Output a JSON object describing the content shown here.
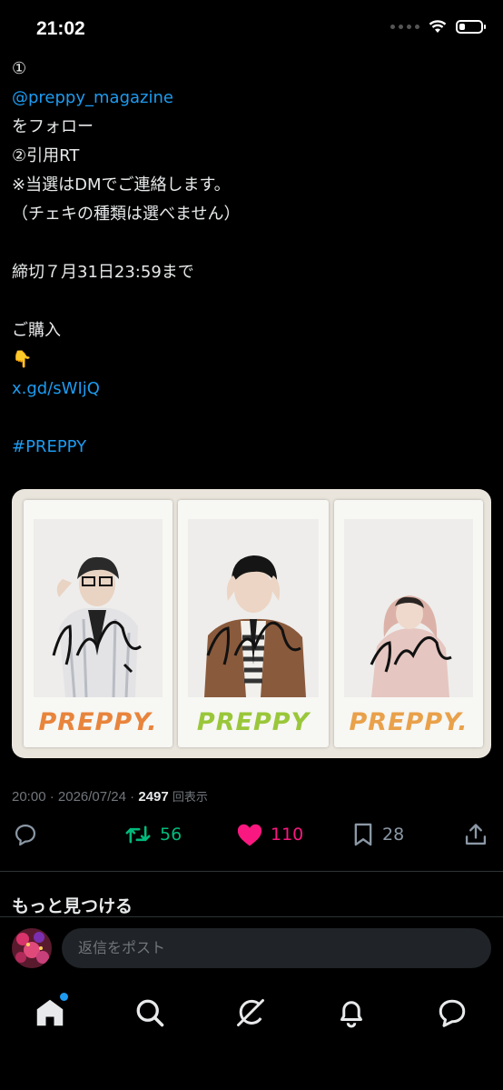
{
  "status_bar": {
    "time": "21:02"
  },
  "tweet": {
    "lines": [
      {
        "text": "①",
        "type": "text"
      },
      {
        "text": "@preppy_magazine",
        "type": "link"
      },
      {
        "text": "をフォロー",
        "type": "text"
      },
      {
        "text": "②引用RT",
        "type": "text"
      },
      {
        "text": "※当選はDMでご連絡します。",
        "type": "text"
      },
      {
        "text": "（チェキの種類は選べません）",
        "type": "text"
      },
      {
        "text": "",
        "type": "text"
      },
      {
        "text": "締切７月31日23:59まで",
        "type": "text"
      },
      {
        "text": "",
        "type": "text"
      },
      {
        "text": "ご購入",
        "type": "text"
      },
      {
        "text": "👇",
        "type": "emoji"
      },
      {
        "text": "x.gd/sWIjQ",
        "type": "link"
      },
      {
        "text": "",
        "type": "text"
      },
      {
        "text": "#PREPPY",
        "type": "link"
      }
    ],
    "photo_captions": [
      "PREPPY.",
      "PREPPY",
      "PREPPY."
    ],
    "caption_colors": [
      "#e8843c",
      "#9ac73a",
      "#e9a14a"
    ],
    "meta": {
      "time": "20:00",
      "date": "2026/07/24",
      "views": "2497",
      "views_label": "回表示"
    },
    "actions": {
      "reply_icon": "reply-icon",
      "retweet_count": "56",
      "retweet_color": "#00ba7c",
      "like_count": "110",
      "like_color": "#f91880",
      "bookmark_count": "28",
      "share_icon": "share-icon"
    }
  },
  "more_section": {
    "title": "もっと見つける"
  },
  "reply_bar": {
    "placeholder": "返信をポスト"
  },
  "tabbar": {
    "items": [
      "home-icon",
      "search-icon",
      "grok-icon",
      "notifications-icon",
      "messages-icon"
    ],
    "accent": "#1d9bf0"
  }
}
